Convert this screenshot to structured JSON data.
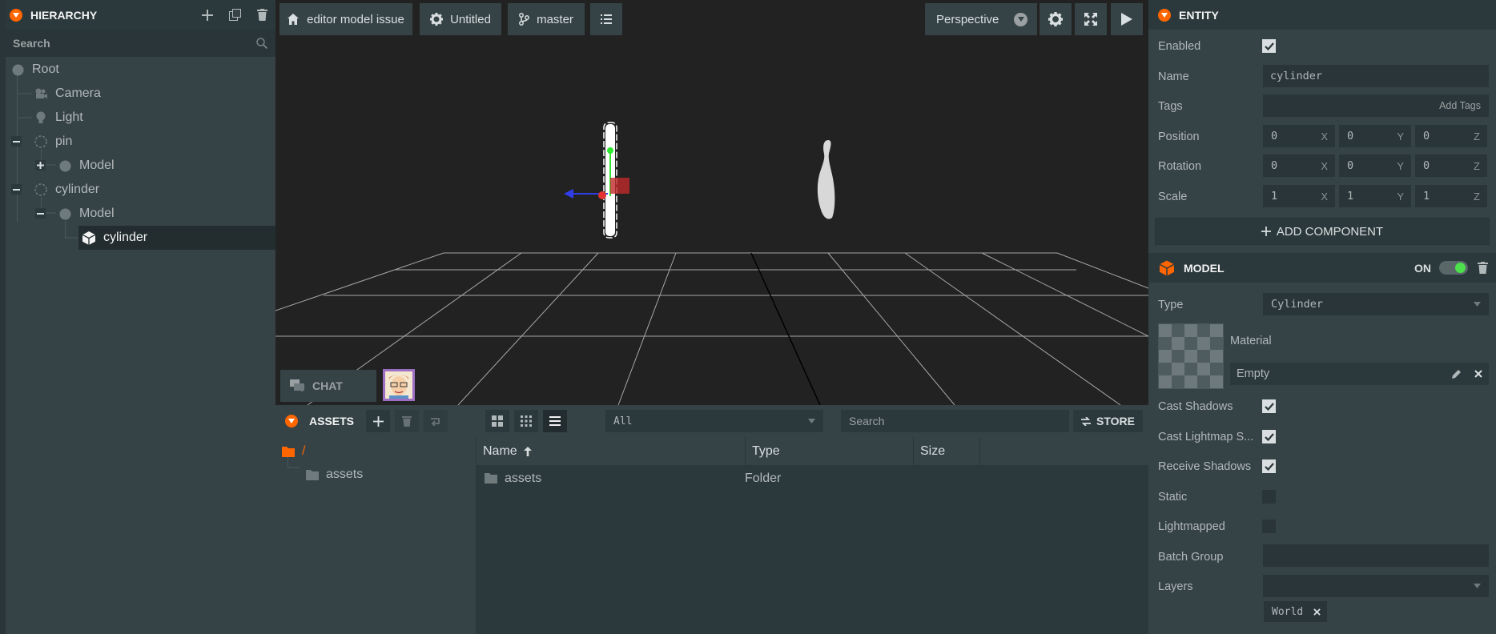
{
  "hierarchy": {
    "title": "HIERARCHY",
    "search_placeholder": "Search",
    "items": [
      {
        "label": "Root"
      },
      {
        "label": "Camera"
      },
      {
        "label": "Light"
      },
      {
        "label": "pin"
      },
      {
        "label": "Model"
      },
      {
        "label": "cylinder"
      },
      {
        "label": "Model"
      },
      {
        "label": "cylinder"
      }
    ]
  },
  "toolbar": {
    "project": "editor model issue",
    "scene": "Untitled",
    "branch": "master",
    "camera": "Perspective"
  },
  "chat": {
    "label": "CHAT"
  },
  "assets": {
    "title": "ASSETS",
    "filter": "All",
    "search_placeholder": "Search",
    "store_label": "STORE",
    "tree": {
      "root": "/",
      "child": "assets"
    },
    "columns": {
      "name": "Name",
      "type": "Type",
      "size": "Size"
    },
    "rows": [
      {
        "name": "assets",
        "type": "Folder",
        "size": ""
      }
    ]
  },
  "entity": {
    "title": "ENTITY",
    "enabled_label": "Enabled",
    "name_label": "Name",
    "name_value": "cylinder",
    "tags_label": "Tags",
    "tags_placeholder": "Add Tags",
    "position_label": "Position",
    "rotation_label": "Rotation",
    "scale_label": "Scale",
    "position": [
      "0",
      "0",
      "0"
    ],
    "rotation": [
      "0",
      "0",
      "0"
    ],
    "scale": [
      "1",
      "1",
      "1"
    ],
    "axes": [
      "X",
      "Y",
      "Z"
    ],
    "add_component": "ADD COMPONENT"
  },
  "model": {
    "title": "MODEL",
    "toggle_label": "ON",
    "type_label": "Type",
    "type_value": "Cylinder",
    "material_label": "Material",
    "material_value": "Empty",
    "cast_shadows_label": "Cast Shadows",
    "cast_lightmap_label": "Cast Lightmap S...",
    "receive_shadows_label": "Receive Shadows",
    "static_label": "Static",
    "lightmapped_label": "Lightmapped",
    "batch_group_label": "Batch Group",
    "layers_label": "Layers",
    "layer_tag": "World"
  },
  "colors": {
    "accent": "#ff6600",
    "panel": "#364346",
    "panel_dark": "#2c393c",
    "field": "#293538",
    "viewport": "#222222",
    "toggle_on": "#4ce04c"
  }
}
